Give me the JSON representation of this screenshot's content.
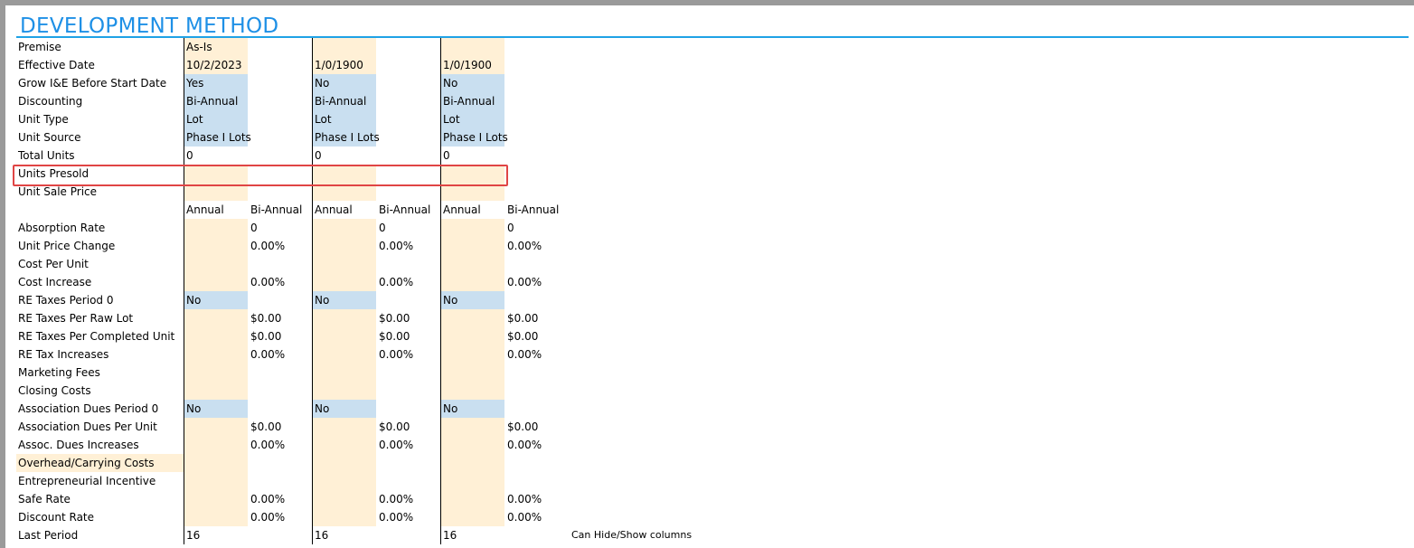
{
  "section": {
    "title": "DEVELOPMENT METHOD",
    "note": "Can Hide/Show columns"
  },
  "labels": [
    "Premise",
    "Effective Date",
    "Grow I&E Before Start Date",
    "Discounting",
    "Unit Type",
    "Unit Source",
    "Total Units",
    "Units Presold",
    "Unit Sale Price",
    "",
    "Absorption Rate",
    "Unit Price Change",
    "Cost Per Unit",
    "Cost Increase",
    "RE Taxes Period 0",
    "RE Taxes Per Raw Lot",
    "RE Taxes Per Completed Unit",
    "RE Tax Increases",
    "Marketing Fees",
    "Closing Costs",
    "Association Dues Period 0",
    "Association Dues Per Unit",
    "Assoc. Dues Increases",
    "Overhead/Carrying Costs",
    "Entrepreneurial Incentive",
    "Safe Rate",
    "Discount Rate",
    "Last Period"
  ],
  "columns": [
    {
      "premise": "As-Is",
      "effective_date": "10/2/2023",
      "grow": "Yes",
      "discounting": "Bi-Annual",
      "unit_type": "Lot",
      "unit_source": "Phase I Lots",
      "total_units": "0",
      "hdr_annual": "Annual",
      "hdr_biannual": "Bi-Annual",
      "absorption": "0",
      "unit_price_change": "0.00%",
      "cost_increase": "0.00%",
      "re_taxes_period0": "No",
      "re_taxes_raw_lot": "$0.00",
      "re_taxes_completed": "$0.00",
      "re_tax_increases": "0.00%",
      "assoc_dues_period0": "No",
      "assoc_dues_per_unit": "$0.00",
      "assoc_dues_increases": "0.00%",
      "safe_rate": "0.00%",
      "discount_rate": "0.00%",
      "last_period": "16"
    },
    {
      "premise": "",
      "effective_date": "1/0/1900",
      "grow": "No",
      "discounting": "Bi-Annual",
      "unit_type": "Lot",
      "unit_source": "Phase I Lots",
      "total_units": "0",
      "hdr_annual": "Annual",
      "hdr_biannual": "Bi-Annual",
      "absorption": "0",
      "unit_price_change": "0.00%",
      "cost_increase": "0.00%",
      "re_taxes_period0": "No",
      "re_taxes_raw_lot": "$0.00",
      "re_taxes_completed": "$0.00",
      "re_tax_increases": "0.00%",
      "assoc_dues_period0": "No",
      "assoc_dues_per_unit": "$0.00",
      "assoc_dues_increases": "0.00%",
      "safe_rate": "0.00%",
      "discount_rate": "0.00%",
      "last_period": "16"
    },
    {
      "premise": "",
      "effective_date": "1/0/1900",
      "grow": "No",
      "discounting": "Bi-Annual",
      "unit_type": "Lot",
      "unit_source": "Phase I Lots",
      "total_units": "0",
      "hdr_annual": "Annual",
      "hdr_biannual": "Bi-Annual",
      "absorption": "0",
      "unit_price_change": "0.00%",
      "cost_increase": "0.00%",
      "re_taxes_period0": "No",
      "re_taxes_raw_lot": "$0.00",
      "re_taxes_completed": "$0.00",
      "re_tax_increases": "0.00%",
      "assoc_dues_period0": "No",
      "assoc_dues_per_unit": "$0.00",
      "assoc_dues_increases": "0.00%",
      "safe_rate": "0.00%",
      "discount_rate": "0.00%",
      "last_period": "16"
    }
  ],
  "colors": {
    "accent": "#1e90e6",
    "beige": "#fff0d6",
    "blue": "#c9dff0",
    "highlight": "#e04545"
  }
}
